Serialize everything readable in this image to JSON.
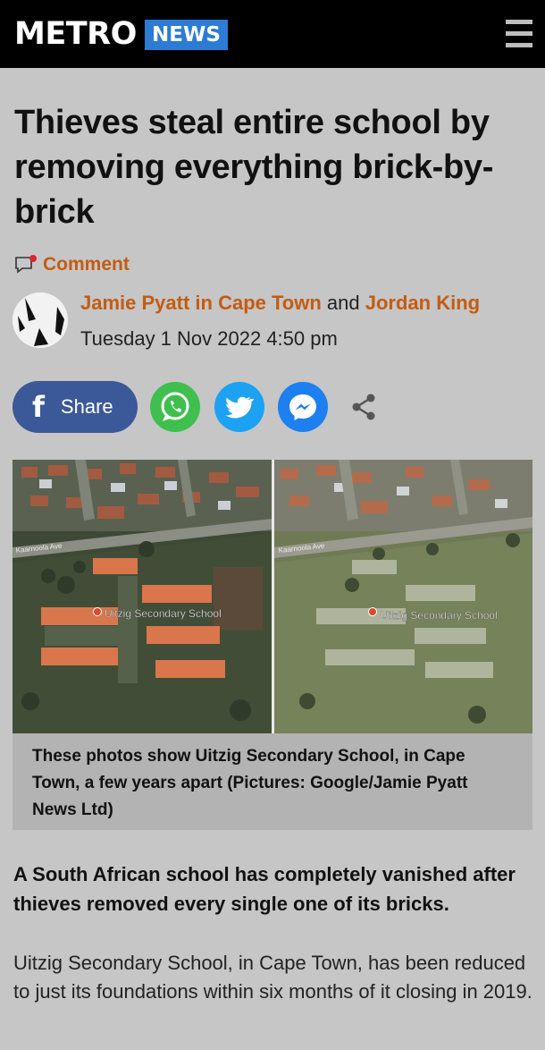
{
  "header": {
    "logo_primary": "METRO",
    "logo_section": "NEWS",
    "menu_icon": "hamburger-menu-icon",
    "background_color": "#000000",
    "section_color": "#2c7bd4"
  },
  "article": {
    "headline": "Thieves steal entire school by removing everything brick-by-brick",
    "comment_label": "Comment",
    "byline": {
      "author1": "Jamie Pyatt in Cape Town",
      "conjunction": "and",
      "author2": "Jordan King",
      "date": "Tuesday 1 Nov 2022 4:50 pm"
    },
    "share": {
      "facebook_label": "Share",
      "buttons": [
        "facebook-icon",
        "whatsapp-icon",
        "twitter-icon",
        "messenger-icon",
        "share-icon"
      ]
    },
    "image": {
      "left_street_label": "Kaarnoola Ave",
      "right_street_label": "Kaarnoola Ave",
      "left_place_label": "Uitzig Secondary School",
      "right_place_label": "Uitzig Secondary School"
    },
    "caption": "These photos show Uitzig Secondary School, in Cape Town, a few years apart (Pictures: Google/Jamie Pyatt News Ltd)",
    "lead": "A South African school has completely vanished after thieves removed every single one of its bricks.",
    "paragraph1": "Uitzig Secondary School, in Cape Town, has been reduced to just its foundations within six months of it closing in 2019."
  },
  "colors": {
    "accent_link": "#c45b12",
    "page_background": "#c6c6c6",
    "facebook": "#3b5998",
    "whatsapp": "#3fbf4e",
    "twitter": "#1da1f2",
    "messenger": "#1d7ff0"
  }
}
